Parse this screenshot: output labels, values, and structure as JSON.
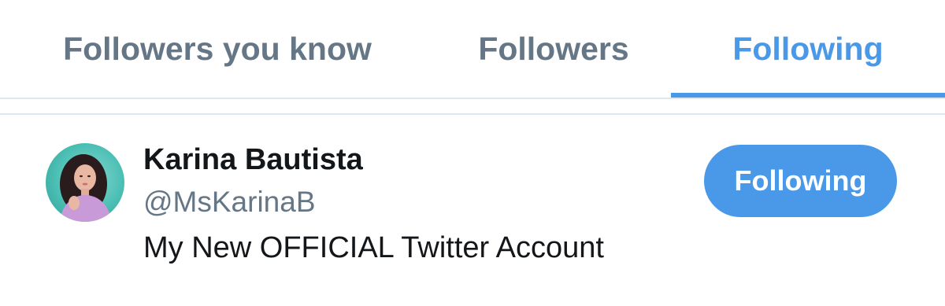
{
  "tabs": [
    {
      "label": "Followers you know",
      "active": false
    },
    {
      "label": "Followers",
      "active": false
    },
    {
      "label": "Following",
      "active": true
    }
  ],
  "colors": {
    "accent": "#4a99e9",
    "inactive_tab": "#657786",
    "primary_text": "#14171a",
    "secondary_text": "#657786",
    "divider": "#e1e8ed"
  },
  "user": {
    "display_name": "Karina Bautista",
    "handle": "@MsKarinaB",
    "bio": "My New OFFICIAL Twitter Account",
    "follow_button_label": "Following",
    "avatar_icon": "profile-photo"
  }
}
